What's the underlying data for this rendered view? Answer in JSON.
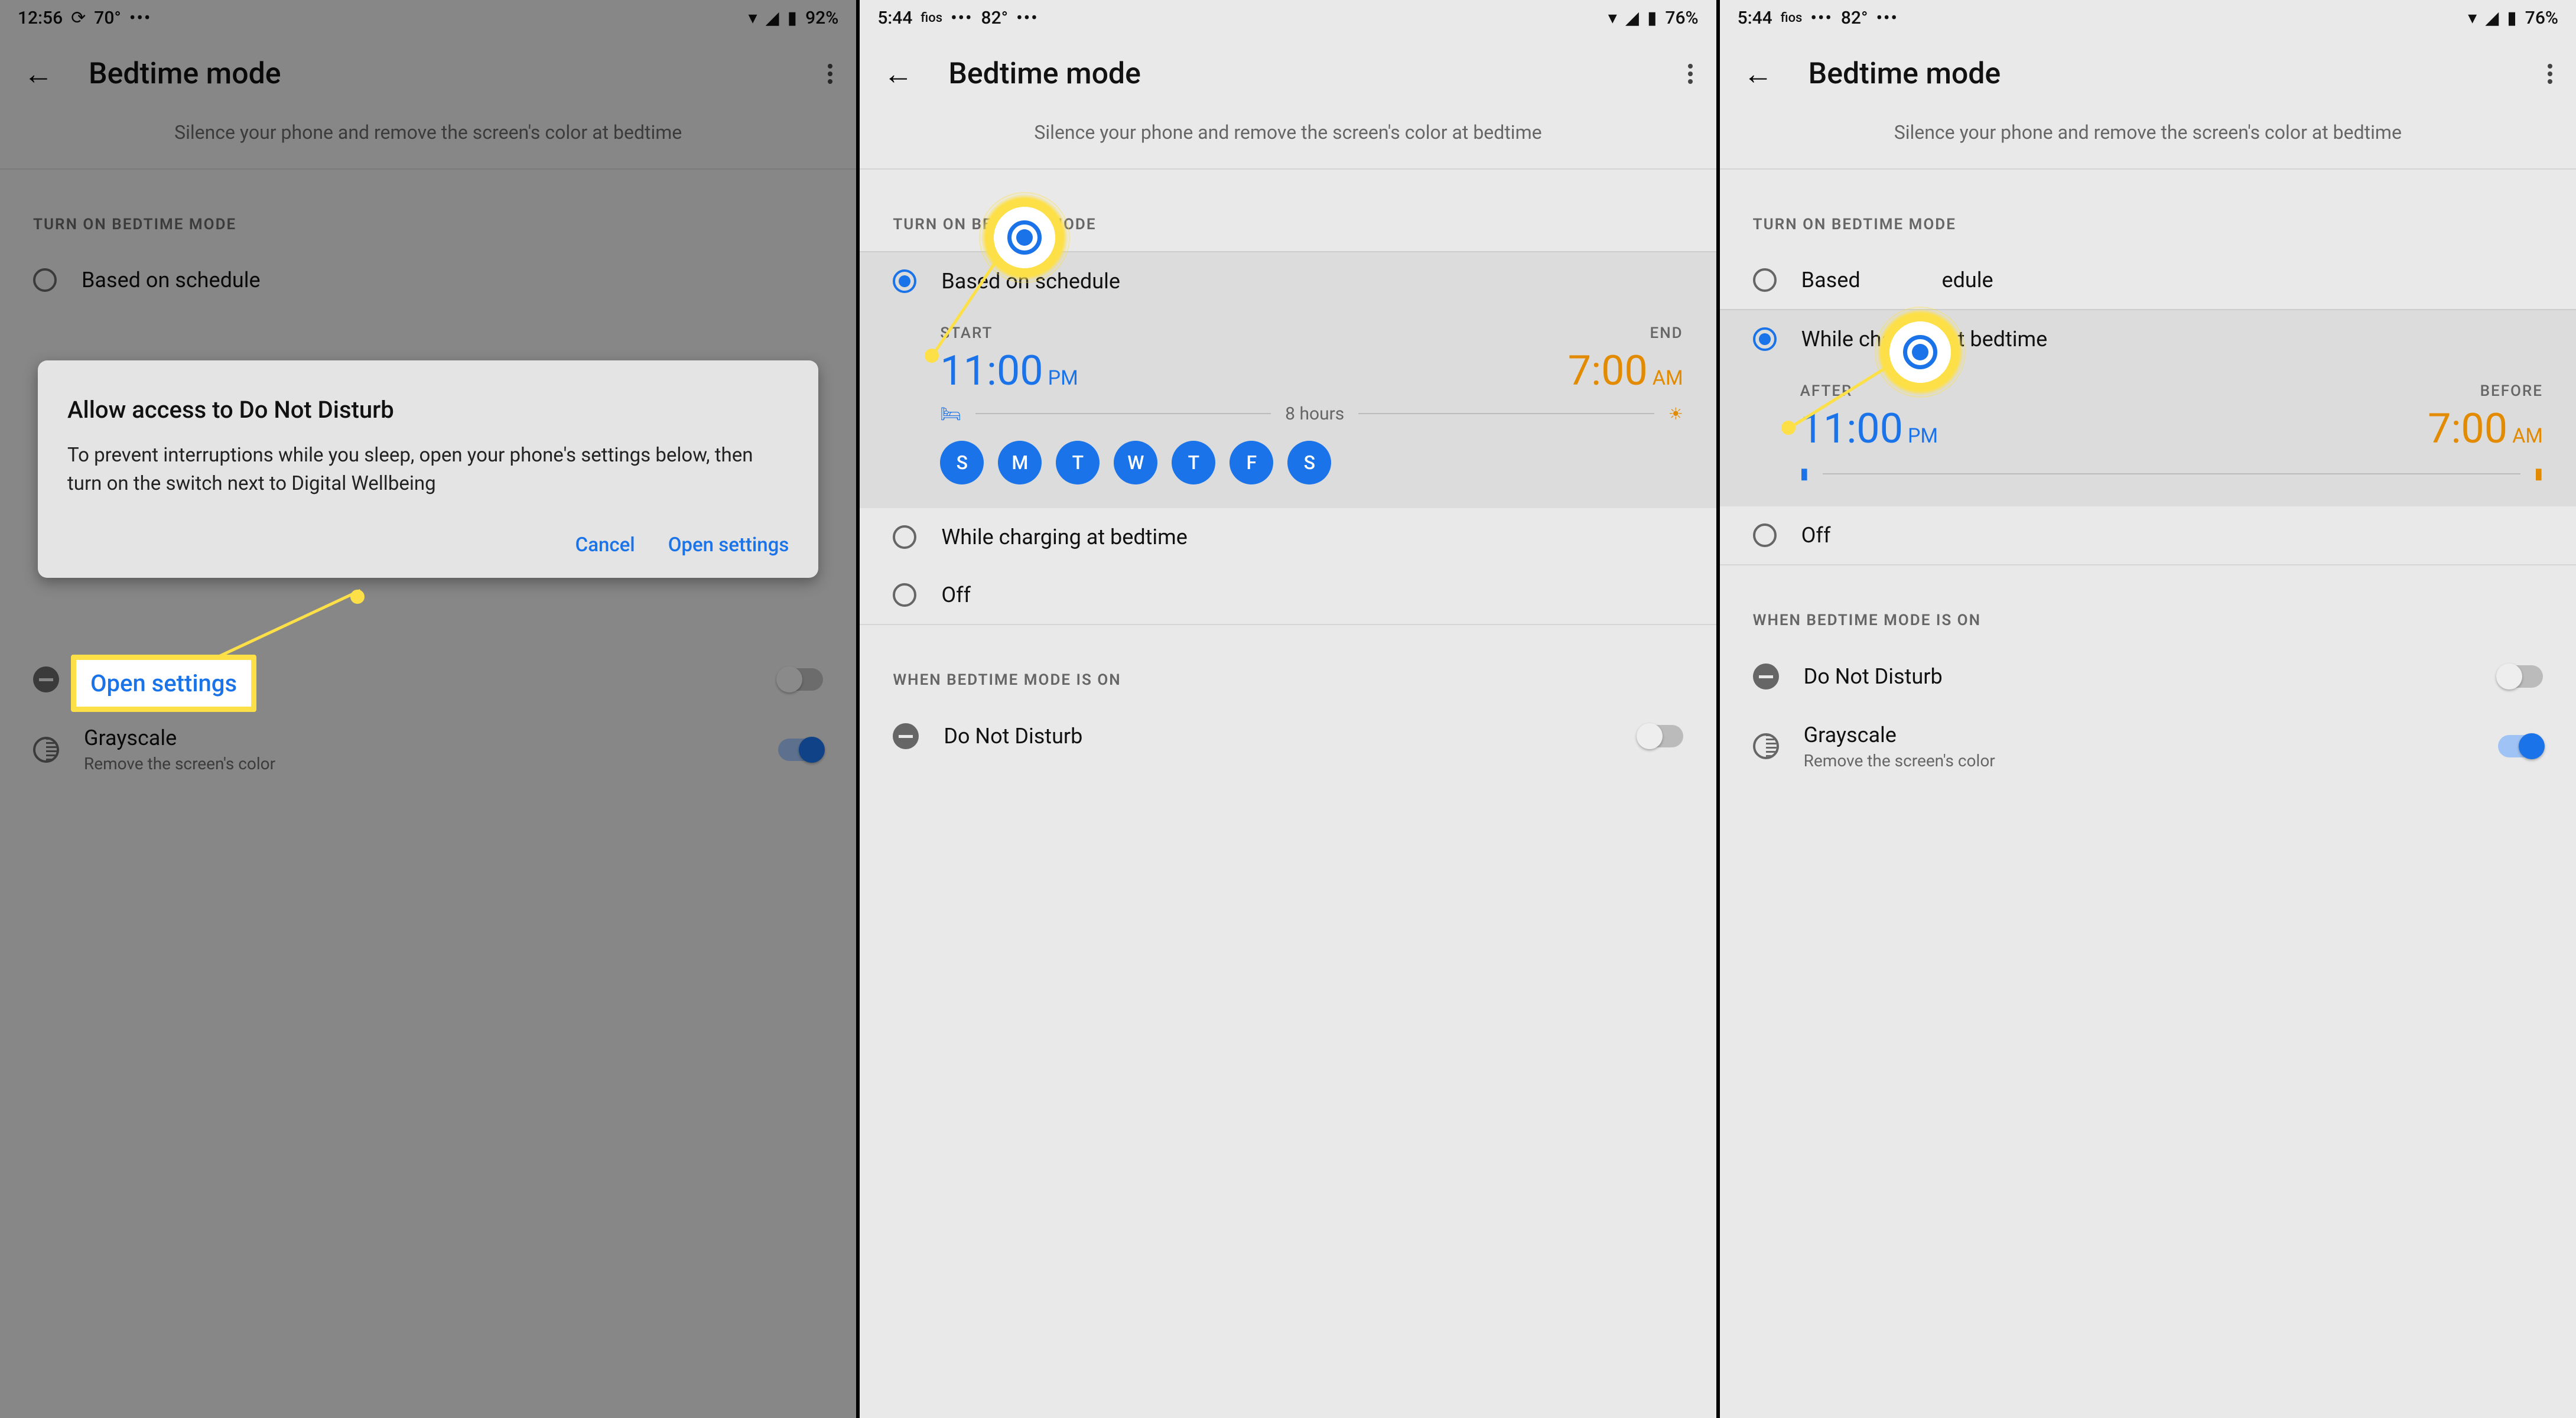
{
  "phones": [
    {
      "status": {
        "time": "12:56",
        "temp": "70°",
        "battery": "92%"
      },
      "title": "Bedtime mode",
      "subtitle": "Silence your phone and remove the screen's color at bedtime",
      "sec_turn_on": "TURN ON BEDTIME MODE",
      "radio_schedule": "Based on schedule",
      "grayscale": {
        "title": "Grayscale",
        "sub": "Remove the screen's color"
      },
      "dialog": {
        "title": "Allow access to Do Not Disturb",
        "body": "To prevent interruptions while you sleep, open your phone's settings below, then turn on the switch next to Digital Wellbeing",
        "cancel": "Cancel",
        "open": "Open settings"
      },
      "callout_label": "Open settings"
    },
    {
      "status": {
        "time": "5:44",
        "carrier": "fios",
        "temp": "82°",
        "battery": "76%"
      },
      "title": "Bedtime mode",
      "subtitle": "Silence your phone and remove the screen's color at bedtime",
      "sec_turn_on": "TURN ON BEDTIME MODE",
      "radio_schedule": "Based on schedule",
      "start_label": "START",
      "end_label": "END",
      "start_time": "11:00",
      "start_ampm": "PM",
      "end_time": "7:00",
      "end_ampm": "AM",
      "duration": "8 hours",
      "days": [
        "S",
        "M",
        "T",
        "W",
        "T",
        "F",
        "S"
      ],
      "radio_charging": "While charging at bedtime",
      "radio_off": "Off",
      "sec_when_on": "WHEN BEDTIME MODE IS ON",
      "dnd": "Do Not Disturb"
    },
    {
      "status": {
        "time": "5:44",
        "carrier": "fios",
        "temp": "82°",
        "battery": "76%"
      },
      "title": "Bedtime mode",
      "subtitle": "Silence your phone and remove the screen's color at bedtime",
      "sec_turn_on": "TURN ON BEDTIME MODE",
      "radio_schedule_partial": "Based",
      "radio_schedule_partial2": "edule",
      "radio_charging": "While charging at bedtime",
      "after_label": "AFTER",
      "before_label": "BEFORE",
      "after_time": "11:00",
      "after_ampm": "PM",
      "before_time": "7:00",
      "before_ampm": "AM",
      "radio_off": "Off",
      "sec_when_on": "WHEN BEDTIME MODE IS ON",
      "dnd": "Do Not Disturb",
      "grayscale": {
        "title": "Grayscale",
        "sub": "Remove the screen's color"
      }
    }
  ]
}
